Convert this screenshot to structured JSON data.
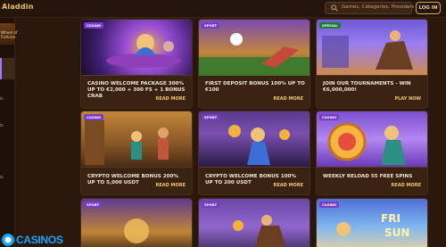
{
  "header": {
    "brand": "Aladdin",
    "search_placeholder": "Games, Categories, Providers",
    "login_label": "LOG IN"
  },
  "sidebar": {
    "wheel_label": "Wheel of Fortune",
    "items": [
      {
        "label": "ln"
      },
      {
        "label": "ts"
      },
      {
        "label": "ts"
      }
    ]
  },
  "cards": [
    {
      "tag": "CASINO",
      "title": "Casino Welcome Package 300% up to €2,000 + 300 FS + 1 Bonus Crab",
      "cta": "Read more"
    },
    {
      "tag": "SPORT",
      "title": "First Deposit Bonus 100% up to €100",
      "cta": "Read more"
    },
    {
      "tag": "SPECIAL",
      "title": "Join Our Tournaments - Win €6,000,000!",
      "cta": "Play now"
    },
    {
      "tag": "CASINO",
      "title": "Crypto Welcome Bonus 200% up to 5,000 USDT",
      "cta": "Read more"
    },
    {
      "tag": "SPORT",
      "title": "Crypto Welcome Bonus 100% up to 200 USDT",
      "cta": "Read more"
    },
    {
      "tag": "CASINO",
      "title": "Weekly Reload 55 Free Spins",
      "cta": "Read more"
    },
    {
      "tag": "SPORT",
      "title": "",
      "cta": ""
    },
    {
      "tag": "SPORT",
      "title": "",
      "cta": ""
    },
    {
      "tag": "CASINO",
      "title": "",
      "cta": ""
    }
  ],
  "watermark": {
    "text": "CASINOS"
  },
  "colors": {
    "accent": "#f4c464",
    "background": "#2a170b",
    "tag": "#7a3cc7"
  }
}
